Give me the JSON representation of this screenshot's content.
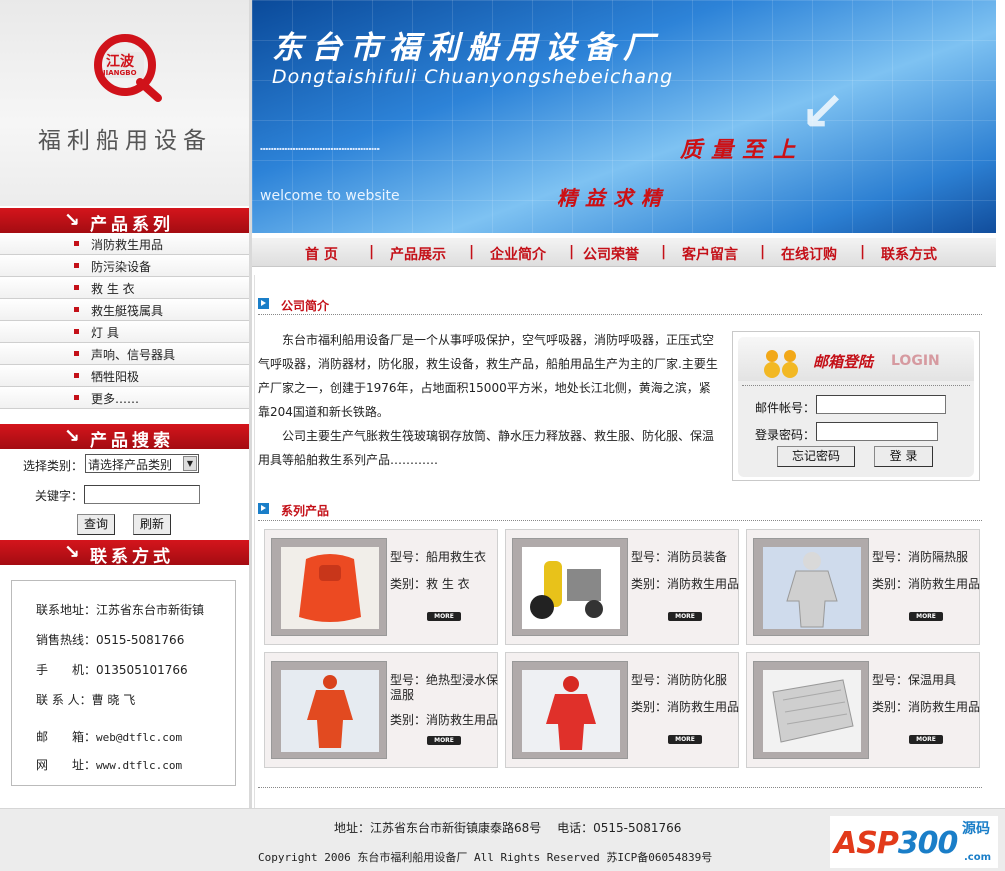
{
  "logo": {
    "brand_cn": "江波",
    "brand_en": "JIANGBO",
    "tagline": "福利船用设备"
  },
  "banner": {
    "title_cn": "东台市福利船用设备厂",
    "title_en": "Dongtaishifuli Chuanyongshebeichang",
    "slogan1": "质量至上",
    "slogan2": "精益求精",
    "welcome": "welcome to website"
  },
  "nav": {
    "items": [
      "首 页",
      "产品展示",
      "企业简介",
      "公司荣誉",
      "客户留言",
      "在线订购",
      "联系方式"
    ],
    "sep": "|"
  },
  "sidebar": {
    "products_title": "产品系列",
    "categories": [
      "消防救生用品",
      "防污染设备",
      "救 生 衣",
      "救生艇筏属具",
      "灯 具",
      "声响、信号器具",
      "牺牲阳极",
      "更多……"
    ],
    "search_title": "产品搜索",
    "search": {
      "category_label": "选择类别：",
      "category_value": "请选择产品类别",
      "keyword_label": "关键字：",
      "query_btn": "查询",
      "refresh_btn": "刷新"
    },
    "contact_title": "联系方式",
    "contact": [
      {
        "label": "联系地址：",
        "value": "江苏省东台市新街镇"
      },
      {
        "label": "销售热线：",
        "value": "0515-5081766"
      },
      {
        "label": "手　　机：",
        "value": "013505101766"
      },
      {
        "label": "联 系 人：",
        "value": "曹 晓 飞"
      },
      {
        "label": "邮　　箱：",
        "value": "web@dtflc.com"
      },
      {
        "label": "网　　址：",
        "value": "www.dtflc.com"
      }
    ]
  },
  "intro": {
    "title": "公司简介",
    "para1": "东台市福利船用设备厂是一个从事呼吸保护，空气呼吸器，消防呼吸器，正压式空气呼吸器，消防器材，防化服，救生设备，救生产品，船舶用品生产为主的厂家.主要生产厂家之一，创建于1976年，占地面积15000平方米，地处长江北侧，黄海之滨，紧靠204国道和新长铁路。",
    "para2": "公司主要生产气胀救生筏玻璃钢存放筒、静水压力释放器、救生服、防化服、保温用具等船舶救生系列产品…………"
  },
  "login": {
    "title": "邮箱登陆",
    "title_en": "LOGIN",
    "account_label": "邮件帐号：",
    "password_label": "登录密码：",
    "forgot_btn": "忘记密码",
    "login_btn": "登 录"
  },
  "products": {
    "title": "系列产品",
    "model_prefix": "型号：",
    "category_prefix": "类别：",
    "more": "MORE",
    "items": [
      {
        "model": "船用救生衣",
        "category": "救 生 衣"
      },
      {
        "model": "消防员装备",
        "category": "消防救生用品"
      },
      {
        "model": "消防隔热服",
        "category": "消防救生用品"
      },
      {
        "model": "绝热型浸水保温服",
        "category": "消防救生用品"
      },
      {
        "model": "消防防化服",
        "category": "消防救生用品"
      },
      {
        "model": "保温用具",
        "category": "消防救生用品"
      }
    ]
  },
  "footer": {
    "address": "地址：江苏省东台市新街镇康泰路68号　 电话：0515-5081766",
    "copyright": "Copyright 2006 东台市福利船用设备厂 All Rights Reserved 苏ICP备06054839号"
  },
  "watermark": {
    "text_a": "ASP",
    "text_b": "300",
    "text_cn": "源码",
    "text_com": ".com"
  },
  "colors": {
    "accent_red": "#c41018",
    "banner_blue": "#2d83d8",
    "icon_blue": "#1a7ec8"
  }
}
